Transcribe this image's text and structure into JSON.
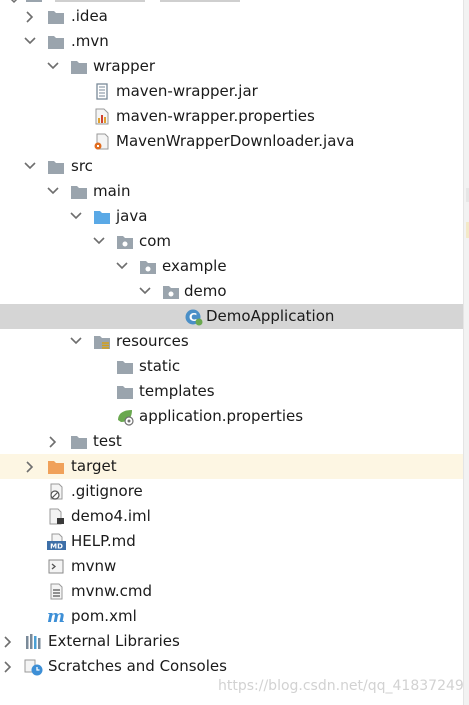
{
  "tree": {
    "items": [
      {
        "label": ".idea",
        "icon": "folder-icon",
        "expanded": false
      },
      {
        "label": ".mvn",
        "icon": "folder-icon",
        "expanded": true
      },
      {
        "label": "wrapper",
        "icon": "folder-icon",
        "expanded": true
      },
      {
        "label": "maven-wrapper.jar",
        "icon": "jar-file-icon"
      },
      {
        "label": "maven-wrapper.properties",
        "icon": "properties-file-icon"
      },
      {
        "label": "MavenWrapperDownloader.java",
        "icon": "java-file-icon"
      },
      {
        "label": "src",
        "icon": "folder-icon",
        "expanded": true
      },
      {
        "label": "main",
        "icon": "folder-icon",
        "expanded": true
      },
      {
        "label": "java",
        "icon": "source-folder-icon",
        "expanded": true
      },
      {
        "label": "com",
        "icon": "package-icon",
        "expanded": true
      },
      {
        "label": "example",
        "icon": "package-icon",
        "expanded": true
      },
      {
        "label": "demo",
        "icon": "package-icon",
        "expanded": true
      },
      {
        "label": "DemoApplication",
        "icon": "spring-class-icon",
        "selected": true
      },
      {
        "label": "resources",
        "icon": "resources-folder-icon",
        "expanded": true
      },
      {
        "label": "static",
        "icon": "folder-icon"
      },
      {
        "label": "templates",
        "icon": "folder-icon"
      },
      {
        "label": "application.properties",
        "icon": "spring-properties-icon"
      },
      {
        "label": "test",
        "icon": "folder-icon",
        "expanded": false
      },
      {
        "label": "target",
        "icon": "excluded-folder-icon",
        "expanded": false
      },
      {
        "label": ".gitignore",
        "icon": "gitignore-file-icon"
      },
      {
        "label": "demo4.iml",
        "icon": "iml-file-icon"
      },
      {
        "label": "HELP.md",
        "icon": "markdown-file-icon"
      },
      {
        "label": "mvnw",
        "icon": "shell-file-icon"
      },
      {
        "label": "mvnw.cmd",
        "icon": "cmd-file-icon"
      },
      {
        "label": "pom.xml",
        "icon": "maven-pom-icon"
      },
      {
        "label": "External Libraries",
        "icon": "libraries-icon",
        "expanded": false
      },
      {
        "label": "Scratches and Consoles",
        "icon": "scratches-icon",
        "expanded": false
      }
    ]
  },
  "watermark": "https://blog.csdn.net/qq_41837249",
  "colors": {
    "folder": "#9aa4ad",
    "source_folder": "#5aa9e6",
    "excluded_folder": "#f0a15a",
    "selection": "#d5d5d5",
    "java_orange": "#e06c1f",
    "spring_green": "#6aa84f",
    "maven_blue": "#3d8fd6"
  }
}
